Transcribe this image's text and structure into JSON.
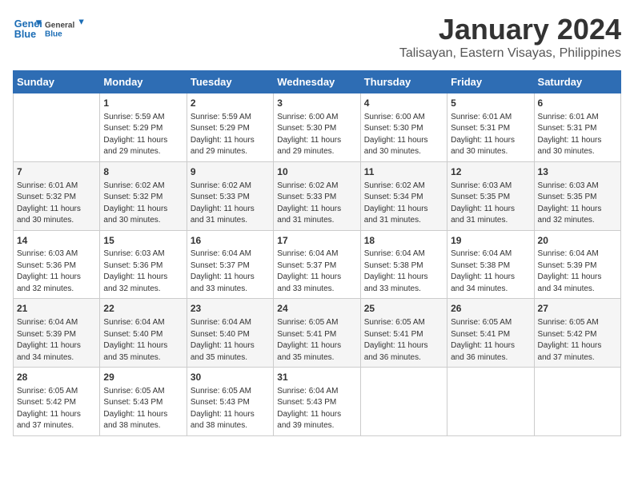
{
  "logo": {
    "line1": "General",
    "line2": "Blue"
  },
  "title": "January 2024",
  "subtitle": "Talisayan, Eastern Visayas, Philippines",
  "headers": [
    "Sunday",
    "Monday",
    "Tuesday",
    "Wednesday",
    "Thursday",
    "Friday",
    "Saturday"
  ],
  "weeks": [
    [
      {
        "day": "",
        "content": ""
      },
      {
        "day": "1",
        "content": "Sunrise: 5:59 AM\nSunset: 5:29 PM\nDaylight: 11 hours\nand 29 minutes."
      },
      {
        "day": "2",
        "content": "Sunrise: 5:59 AM\nSunset: 5:29 PM\nDaylight: 11 hours\nand 29 minutes."
      },
      {
        "day": "3",
        "content": "Sunrise: 6:00 AM\nSunset: 5:30 PM\nDaylight: 11 hours\nand 29 minutes."
      },
      {
        "day": "4",
        "content": "Sunrise: 6:00 AM\nSunset: 5:30 PM\nDaylight: 11 hours\nand 30 minutes."
      },
      {
        "day": "5",
        "content": "Sunrise: 6:01 AM\nSunset: 5:31 PM\nDaylight: 11 hours\nand 30 minutes."
      },
      {
        "day": "6",
        "content": "Sunrise: 6:01 AM\nSunset: 5:31 PM\nDaylight: 11 hours\nand 30 minutes."
      }
    ],
    [
      {
        "day": "7",
        "content": "Sunrise: 6:01 AM\nSunset: 5:32 PM\nDaylight: 11 hours\nand 30 minutes."
      },
      {
        "day": "8",
        "content": "Sunrise: 6:02 AM\nSunset: 5:32 PM\nDaylight: 11 hours\nand 30 minutes."
      },
      {
        "day": "9",
        "content": "Sunrise: 6:02 AM\nSunset: 5:33 PM\nDaylight: 11 hours\nand 31 minutes."
      },
      {
        "day": "10",
        "content": "Sunrise: 6:02 AM\nSunset: 5:33 PM\nDaylight: 11 hours\nand 31 minutes."
      },
      {
        "day": "11",
        "content": "Sunrise: 6:02 AM\nSunset: 5:34 PM\nDaylight: 11 hours\nand 31 minutes."
      },
      {
        "day": "12",
        "content": "Sunrise: 6:03 AM\nSunset: 5:35 PM\nDaylight: 11 hours\nand 31 minutes."
      },
      {
        "day": "13",
        "content": "Sunrise: 6:03 AM\nSunset: 5:35 PM\nDaylight: 11 hours\nand 32 minutes."
      }
    ],
    [
      {
        "day": "14",
        "content": "Sunrise: 6:03 AM\nSunset: 5:36 PM\nDaylight: 11 hours\nand 32 minutes."
      },
      {
        "day": "15",
        "content": "Sunrise: 6:03 AM\nSunset: 5:36 PM\nDaylight: 11 hours\nand 32 minutes."
      },
      {
        "day": "16",
        "content": "Sunrise: 6:04 AM\nSunset: 5:37 PM\nDaylight: 11 hours\nand 33 minutes."
      },
      {
        "day": "17",
        "content": "Sunrise: 6:04 AM\nSunset: 5:37 PM\nDaylight: 11 hours\nand 33 minutes."
      },
      {
        "day": "18",
        "content": "Sunrise: 6:04 AM\nSunset: 5:38 PM\nDaylight: 11 hours\nand 33 minutes."
      },
      {
        "day": "19",
        "content": "Sunrise: 6:04 AM\nSunset: 5:38 PM\nDaylight: 11 hours\nand 34 minutes."
      },
      {
        "day": "20",
        "content": "Sunrise: 6:04 AM\nSunset: 5:39 PM\nDaylight: 11 hours\nand 34 minutes."
      }
    ],
    [
      {
        "day": "21",
        "content": "Sunrise: 6:04 AM\nSunset: 5:39 PM\nDaylight: 11 hours\nand 34 minutes."
      },
      {
        "day": "22",
        "content": "Sunrise: 6:04 AM\nSunset: 5:40 PM\nDaylight: 11 hours\nand 35 minutes."
      },
      {
        "day": "23",
        "content": "Sunrise: 6:04 AM\nSunset: 5:40 PM\nDaylight: 11 hours\nand 35 minutes."
      },
      {
        "day": "24",
        "content": "Sunrise: 6:05 AM\nSunset: 5:41 PM\nDaylight: 11 hours\nand 35 minutes."
      },
      {
        "day": "25",
        "content": "Sunrise: 6:05 AM\nSunset: 5:41 PM\nDaylight: 11 hours\nand 36 minutes."
      },
      {
        "day": "26",
        "content": "Sunrise: 6:05 AM\nSunset: 5:41 PM\nDaylight: 11 hours\nand 36 minutes."
      },
      {
        "day": "27",
        "content": "Sunrise: 6:05 AM\nSunset: 5:42 PM\nDaylight: 11 hours\nand 37 minutes."
      }
    ],
    [
      {
        "day": "28",
        "content": "Sunrise: 6:05 AM\nSunset: 5:42 PM\nDaylight: 11 hours\nand 37 minutes."
      },
      {
        "day": "29",
        "content": "Sunrise: 6:05 AM\nSunset: 5:43 PM\nDaylight: 11 hours\nand 38 minutes."
      },
      {
        "day": "30",
        "content": "Sunrise: 6:05 AM\nSunset: 5:43 PM\nDaylight: 11 hours\nand 38 minutes."
      },
      {
        "day": "31",
        "content": "Sunrise: 6:04 AM\nSunset: 5:43 PM\nDaylight: 11 hours\nand 39 minutes."
      },
      {
        "day": "",
        "content": ""
      },
      {
        "day": "",
        "content": ""
      },
      {
        "day": "",
        "content": ""
      }
    ]
  ]
}
